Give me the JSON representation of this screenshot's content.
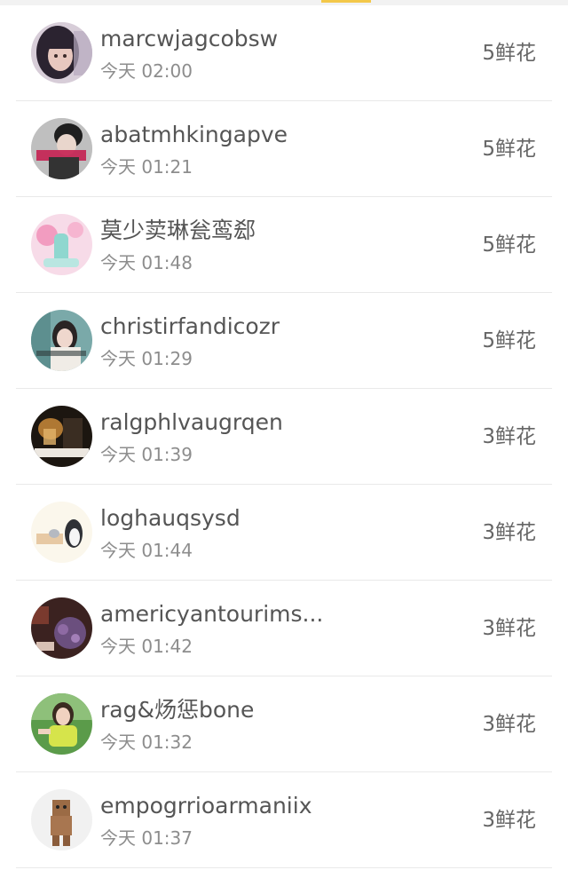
{
  "list": {
    "items": [
      {
        "name": "marcwjagcobsw",
        "time": "今天 02:00",
        "flowers": "5鲜花",
        "avatar": "avatar-girl-portrait"
      },
      {
        "name": "abatmhkingapve",
        "time": "今天 01:21",
        "flowers": "5鲜花",
        "avatar": "avatar-couple-photo"
      },
      {
        "name": "莫少荬琳瓮鸾郄",
        "time": "今天 01:48",
        "flowers": "5鲜花",
        "avatar": "avatar-pink-illustration"
      },
      {
        "name": "christirfandicozr",
        "time": "今天 01:29",
        "flowers": "5鲜花",
        "avatar": "avatar-girl-teal"
      },
      {
        "name": "ralgphlvaugrqen",
        "time": "今天 01:39",
        "flowers": "3鲜花",
        "avatar": "avatar-dark-candle"
      },
      {
        "name": "loghauqsysd",
        "time": "今天 01:44",
        "flowers": "3鲜花",
        "avatar": "avatar-penguin-cartoon"
      },
      {
        "name": "americyantourims...",
        "time": "今天 01:42",
        "flowers": "3鲜花",
        "avatar": "avatar-purple-flowers"
      },
      {
        "name": "rag&炀惩bone",
        "time": "今天 01:32",
        "flowers": "3鲜花",
        "avatar": "avatar-girl-green"
      },
      {
        "name": "empogrrioarmaniix",
        "time": "今天 01:37",
        "flowers": "3鲜花",
        "avatar": "avatar-box-robot"
      }
    ]
  },
  "colors": {
    "accent": "#f3c84a",
    "name_text": "#555555",
    "time_text": "#8d8d8d",
    "divider": "#e9e9e9"
  }
}
